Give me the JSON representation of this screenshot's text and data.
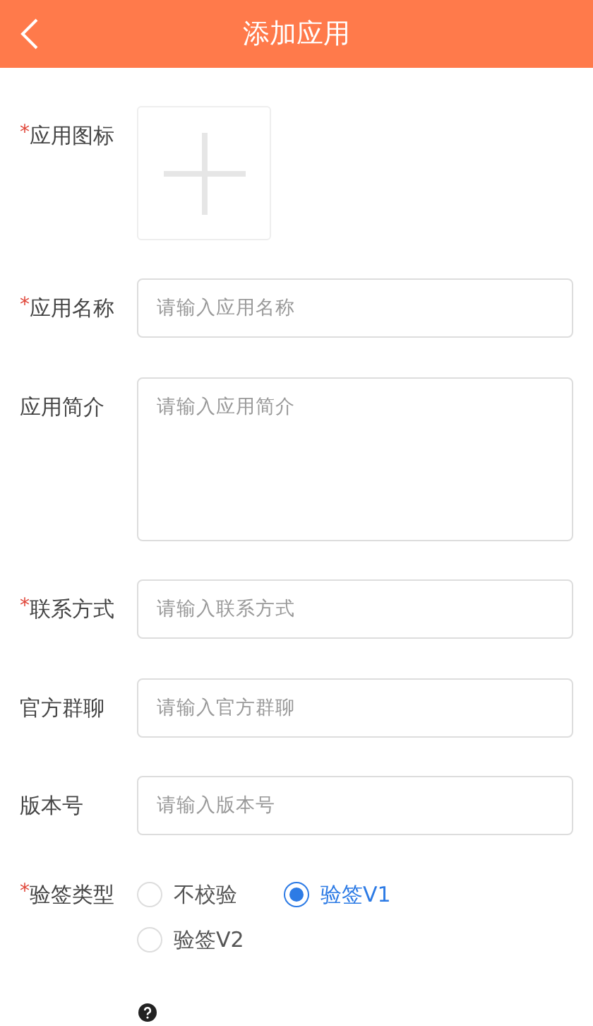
{
  "header": {
    "title": "添加应用"
  },
  "fields": [
    {
      "kind": "upload",
      "label": "应用图标",
      "required_mark": "*"
    },
    {
      "kind": "input",
      "label": "应用名称",
      "required_mark": "*",
      "placeholder": "请输入应用名称"
    },
    {
      "kind": "textarea",
      "label": "应用简介",
      "placeholder": "请输入应用简介"
    },
    {
      "kind": "input",
      "label": "联系方式",
      "required_mark": "*",
      "placeholder": "请输入联系方式"
    },
    {
      "kind": "input",
      "label": "官方群聊",
      "placeholder": "请输入官方群聊"
    },
    {
      "kind": "input",
      "label": "版本号",
      "placeholder": "请输入版本号"
    },
    {
      "kind": "radio",
      "label": "验签类型",
      "required_mark": "*",
      "options": [
        {
          "label": "不校验",
          "selected": false
        },
        {
          "label": "验签V1",
          "selected": true
        },
        {
          "label": "验签V2",
          "selected": false
        }
      ]
    }
  ]
}
